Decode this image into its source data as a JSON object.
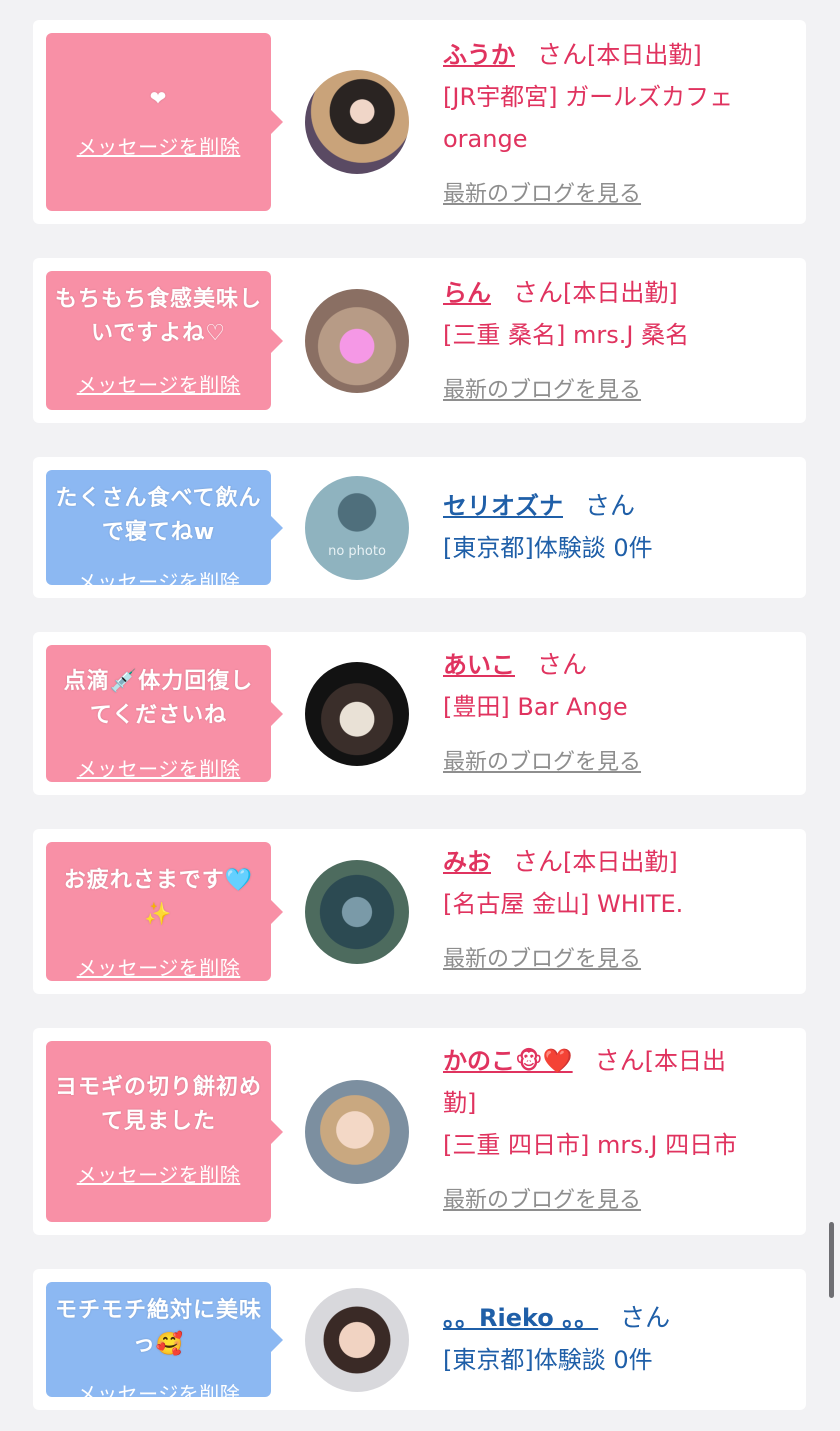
{
  "delete_label": "メッセージを削除",
  "blog_label": "最新のブログを見る",
  "honorific": "さん",
  "colors": {
    "background": "#f2f2f4",
    "bubble_pink": "#f890a6",
    "bubble_blue": "#8cb8f2",
    "text_pink": "#e0335f",
    "text_blue": "#1f5fa8",
    "blog_gray": "#8e8e8e"
  },
  "cards": [
    {
      "message": "❤",
      "name": "ふうか",
      "suffix": "[本日出勤]",
      "shop": "[JR宇都宮] ガールズカフェ",
      "shop2": "orange",
      "avatar": "avatar-photo"
    },
    {
      "message": "もちもち食感美味しいですよね♡",
      "name": "らん",
      "suffix": "[本日出勤]",
      "shop": "[三重 桑名] mrs.J 桑名",
      "avatar": "avatar-photo"
    },
    {
      "message": "たくさん食べて飲んで寝てねw",
      "name": "セリオズナ",
      "suffix": "",
      "shop": "[東京都]体験談 0件",
      "avatar_text": "no photo",
      "avatar": "avatar-placeholder"
    },
    {
      "message": "点滴💉体力回復してくださいね",
      "name": "あいこ",
      "suffix": "",
      "shop": "[豊田] Bar Ange",
      "avatar": "avatar-photo"
    },
    {
      "message": "お疲れさまです🩵✨",
      "name": "みお",
      "suffix": "[本日出勤]",
      "shop": "[名古屋 金山] WHITE.",
      "avatar": "avatar-photo"
    },
    {
      "message": "ヨモギの切り餅初めて見ました",
      "name": "かのこ🐵❤️",
      "suffix": "[本日出",
      "suffix2": "勤]",
      "shop": "[三重 四日市] mrs.J 四日市",
      "avatar": "avatar-photo"
    },
    {
      "message": "モチモチ絶対に美味っ🥰",
      "name": "。。Rieko 。。",
      "suffix": "",
      "shop": "[東京都]体験談 0件",
      "avatar": "avatar-photo"
    }
  ]
}
